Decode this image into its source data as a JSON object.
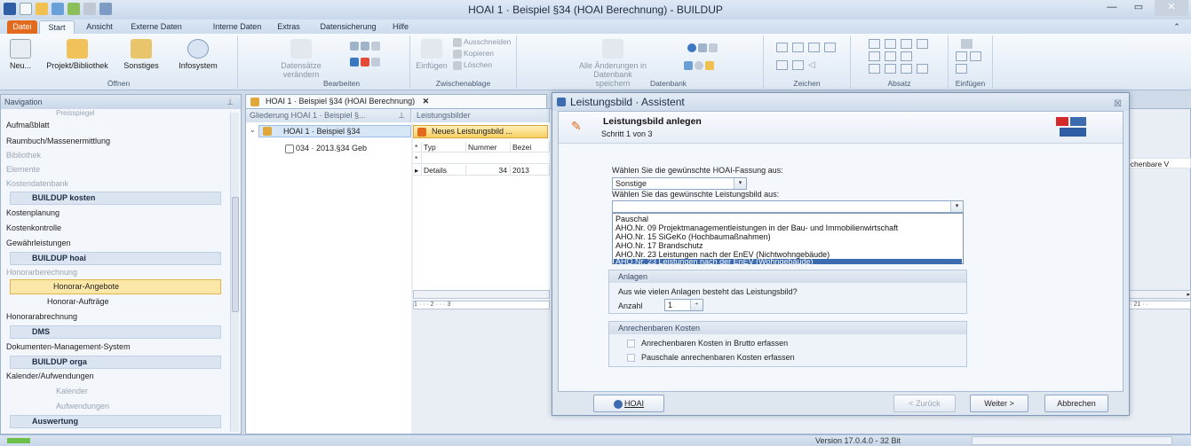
{
  "window": {
    "title": "HOAI 1 · Beispiel §34 (HOAI Berechnung) - BUILDUP"
  },
  "ribbon_tabs": [
    "Datei",
    "Start",
    "Ansicht",
    "Externe Daten",
    "Interne Daten",
    "Extras",
    "Datensicherung",
    "Hilfe"
  ],
  "ribbon": {
    "oeffnen": {
      "label": "Öffnen",
      "neu": "Neu...",
      "projekt": "Projekt/Bibliothek",
      "sonstiges": "Sonstiges",
      "infosystem": "Infosystem"
    },
    "bearbeiten": {
      "label": "Bearbeiten",
      "datensaetze": "Datensätze verändern"
    },
    "zwischenablage": {
      "label": "Zwischenablage",
      "einfuegen": "Einfügen",
      "ausschneiden": "Ausschneiden",
      "kopieren": "Kopieren",
      "loeschen": "Löschen"
    },
    "datenbank": {
      "label": "Datenbank",
      "alle_aenderungen": "Alle Änderungen in Datenbank speichern"
    },
    "zeichen": {
      "label": "Zeichen"
    },
    "absatz": {
      "label": "Absatz"
    },
    "einfuegen": {
      "label": "Einfügen"
    }
  },
  "nav": {
    "header": "Navigation",
    "items": [
      {
        "label": "Preisspiegel"
      },
      {
        "label": "Aufmaßblatt"
      },
      {
        "label": "Raumbuch/Massenermittlung"
      },
      {
        "label": "Bibliothek"
      },
      {
        "label": "Elemente"
      },
      {
        "label": "Kostendatenbank"
      },
      {
        "label": "BUILDUP kosten"
      },
      {
        "label": "Kostenplanung"
      },
      {
        "label": "Kostenkontrolle"
      },
      {
        "label": "Gewährleistungen"
      },
      {
        "label": "BUILDUP hoai"
      },
      {
        "label": "Honorarberechnung"
      },
      {
        "label": "Honorar-Angebote"
      },
      {
        "label": "Honorar-Aufträge"
      },
      {
        "label": "Honorarabrechnung"
      },
      {
        "label": "DMS"
      },
      {
        "label": "Dokumenten-Management-System"
      },
      {
        "label": "BUILDUP orga"
      },
      {
        "label": "Kalender/Aufwendungen"
      },
      {
        "label": "Kalender"
      },
      {
        "label": "Aufwendungen"
      },
      {
        "label": "Auswertung"
      }
    ]
  },
  "document": {
    "tab": "HOAI 1 · Beispiel §34 (HOAI Berechnung)",
    "tree_header": "Gliederung HOAI 1 · Beispiel §...",
    "tree_root": "HOAI 1 · Beispiel §34",
    "tree_child": "034 · 2013.§34 Geb",
    "grid_header": "Leistungsbilder",
    "grid_button": "Neues Leistungsbild ...",
    "grid_cols": [
      "Typ",
      "Nummer",
      "Bezei"
    ],
    "grid_row": {
      "typ": "Details",
      "nummer": "34",
      "bez": "2013"
    },
    "right_header": "echenbare V",
    "ruler_left": "1 · · · 2 · · · 3",
    "ruler_right": "· · 21 · ·"
  },
  "dialog": {
    "title": "Leistungsbild · Assistent",
    "heading": "Leistungsbild anlegen",
    "step": "Schritt 1 von 3",
    "fassung_label": "Wählen Sie die gewünschte HOAI-Fassung aus:",
    "fassung_value": "Sonstige",
    "leistungsbild_label": "Wählen Sie das gewünschte Leistungsbild aus:",
    "leistungsbild_value": "",
    "options": [
      "Pauschal",
      "AHO.Nr. 09 Projektmanagementleistungen in der Bau- und Immobilienwirtschaft",
      "AHO.Nr. 15 SiGeKo (Hochbaumaßnahmen)",
      "AHO.Nr. 17 Brandschutz",
      "AHO.Nr. 23 Leistungen nach der EnEV (Nichtwohngebäude)",
      "AHO.Nr. 23 Leistungen nach der EnEV (Wohngebäude)"
    ],
    "selected_index": 5,
    "anlagen": {
      "title": "Anlagen",
      "question": "Aus wie vielen Anlagen besteht das Leistungsbild?",
      "anzahl_label": "Anzahl",
      "anzahl_value": "1"
    },
    "kosten": {
      "title": "Anrechenbaren Kosten",
      "brutto": "Anrechenbaren Kosten in Brutto erfassen",
      "pauschale": "Pauschale anrechenbaren Kosten erfassen"
    },
    "buttons": {
      "hoai": "HOAI",
      "zurueck": "< Zurück",
      "weiter": "Weiter >",
      "abbrechen": "Abbrechen"
    }
  },
  "status": {
    "version": "Version 17.0.4.0 - 32 Bit"
  },
  "colors": {
    "accent": "#e26a1c",
    "selection": "#3d6bb0",
    "nav_selected": "#fbe7a8"
  }
}
